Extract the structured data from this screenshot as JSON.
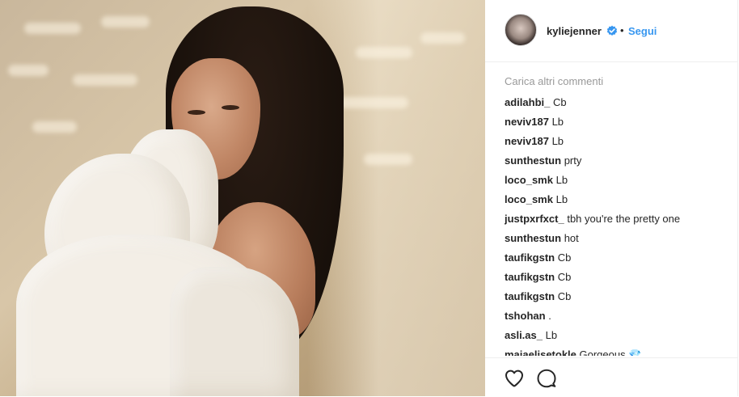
{
  "post": {
    "image_alt": "kyliejenner photo",
    "author": {
      "username": "kyliejenner",
      "verified": true,
      "separator": "•",
      "follow_label": "Segui"
    }
  },
  "comments": {
    "load_more_label": "Carica altri commenti",
    "items": [
      {
        "user": "adilahbi_",
        "text": "Cb"
      },
      {
        "user": "neviv187",
        "text": "Lb"
      },
      {
        "user": "neviv187",
        "text": "Lb"
      },
      {
        "user": "sunthestun",
        "text": "prty"
      },
      {
        "user": "loco_smk",
        "text": "Lb"
      },
      {
        "user": "loco_smk",
        "text": "Lb"
      },
      {
        "user": "justpxrfxct_",
        "text": "tbh you're the pretty one"
      },
      {
        "user": "sunthestun",
        "text": "hot"
      },
      {
        "user": "taufikgstn",
        "text": "Cb"
      },
      {
        "user": "taufikgstn",
        "text": "Cb"
      },
      {
        "user": "taufikgstn",
        "text": "Cb"
      },
      {
        "user": "tshohan",
        "text": "."
      },
      {
        "user": "asli.as_",
        "text": "Lb"
      },
      {
        "user": "maiaelisetokle",
        "text": "Gorgeous 💎"
      }
    ]
  },
  "actions": {
    "like_icon": "heart-icon",
    "comment_icon": "comment-icon"
  },
  "colors": {
    "link_blue": "#3897f0",
    "muted_gray": "#999999",
    "text_dark": "#262626",
    "divider": "#efefef"
  }
}
